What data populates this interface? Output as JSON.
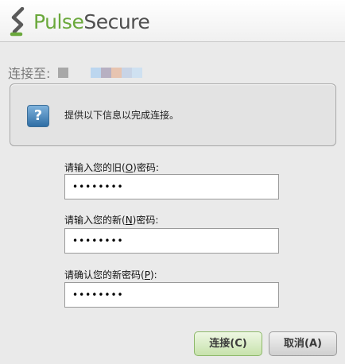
{
  "header": {
    "brand_first": "Pulse",
    "brand_second": "Secure",
    "logo_icon": "pulse-secure-logo-icon",
    "colors": {
      "brand_green": "#6aa83b",
      "brand_gray": "#4f4f4f"
    }
  },
  "connection": {
    "label": "连接至:",
    "target_redacted": true
  },
  "info": {
    "icon": "help-question-icon",
    "message": "提供以下信息以完成连接。"
  },
  "form": {
    "old_password": {
      "label_pre": "请输入您的旧(",
      "label_key": "O",
      "label_post": ")密码:",
      "value": "••••••••"
    },
    "new_password": {
      "label_pre": "请输入您的新(",
      "label_key": "N",
      "label_post": ")密码:",
      "value": "••••••••"
    },
    "confirm_password": {
      "label_pre": "请确认您的新密码(",
      "label_key": "P",
      "label_post": "):",
      "value": "••••••••"
    }
  },
  "actions": {
    "connect_label": "连接(C)",
    "cancel_label": "取消(A)"
  }
}
